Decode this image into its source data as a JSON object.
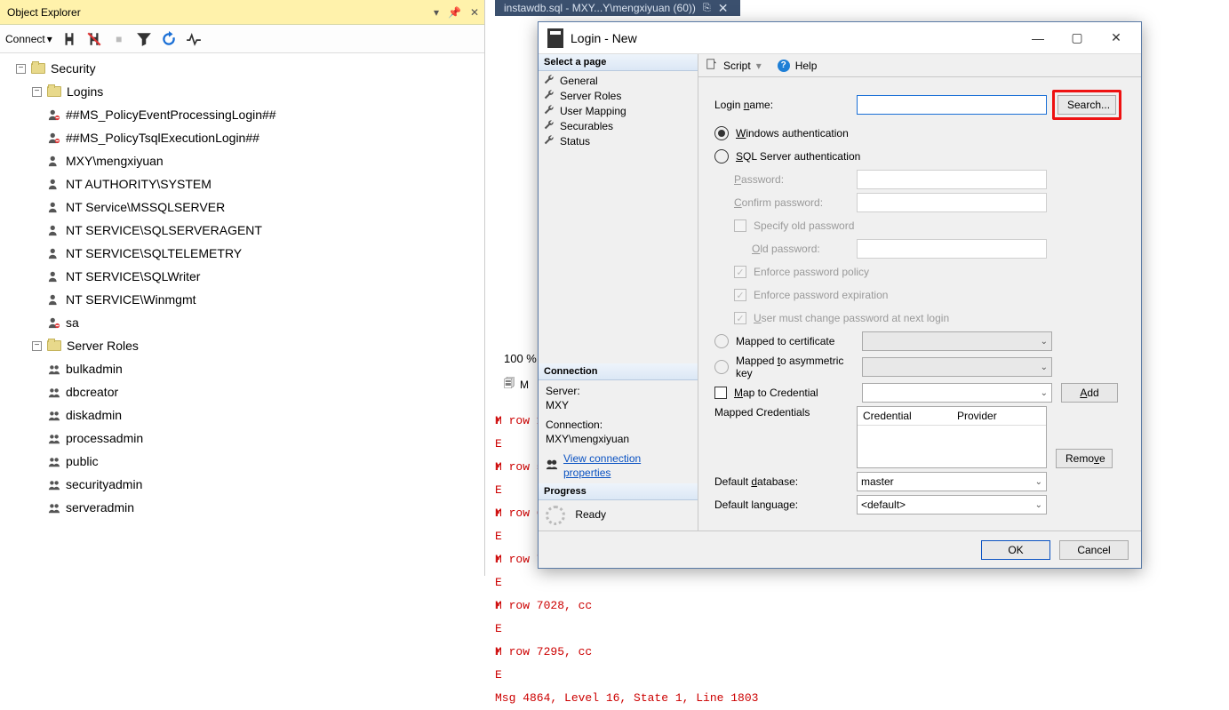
{
  "objectExplorer": {
    "title": "Object Explorer",
    "connectLabel": "Connect",
    "tree": {
      "security": "Security",
      "logins": "Logins",
      "loginItems": [
        "##MS_PolicyEventProcessingLogin##",
        "##MS_PolicyTsqlExecutionLogin##",
        "MXY\\mengxiyuan",
        "NT AUTHORITY\\SYSTEM",
        "NT Service\\MSSQLSERVER",
        "NT SERVICE\\SQLSERVERAGENT",
        "NT SERVICE\\SQLTELEMETRY",
        "NT SERVICE\\SQLWriter",
        "NT SERVICE\\Winmgmt",
        "sa"
      ],
      "serverRoles": "Server Roles",
      "roleItems": [
        "bulkadmin",
        "dbcreator",
        "diskadmin",
        "processadmin",
        "public",
        "securityadmin",
        "serveradmin"
      ]
    }
  },
  "docTab": {
    "label": "instawdb.sql - MXY...Y\\mengxiyuan (60))"
  },
  "bg": {
    "zoom": "100 %",
    "msgIcon": "M",
    "errorsLeft": "M\nE\nM\nE\nM\nE\nM\nE\nM\nE\nM\nE\nMsg 4864, Level 16, State 1, Line 1803",
    "errorsRight": "r row 1687, cc\n\nr row 5167, cc\n\nr row 6612, cc\n\nr row 7020, cc\n\nr row 7028, cc\n\nr row 7295, cc"
  },
  "dialog": {
    "title": "Login - New",
    "leftHeader": "Select a page",
    "pages": [
      "General",
      "Server Roles",
      "User Mapping",
      "Securables",
      "Status"
    ],
    "connHeader": "Connection",
    "serverLbl": "Server:",
    "serverVal": "MXY",
    "connectionLbl": "Connection:",
    "connectionVal": "MXY\\mengxiyuan",
    "viewConn": "View connection properties",
    "progressHeader": "Progress",
    "progressVal": "Ready",
    "scriptLabel": "Script",
    "helpLabel": "Help",
    "loginName": "Login name:",
    "searchBtn": "Search...",
    "winAuth": "Windows authentication",
    "sqlAuth": "SQL Server authentication",
    "password": "Password:",
    "confirm": "Confirm password:",
    "specifyOld": "Specify old password",
    "oldPass": "Old password:",
    "enfPolicy": "Enforce password policy",
    "enfExp": "Enforce password expiration",
    "mustChange": "User must change password at next login",
    "mapCert": "Mapped to certificate",
    "mapAsym": "Mapped to asymmetric key",
    "mapCred": "Map to Credential",
    "addBtn": "Add",
    "mappedCreds": "Mapped Credentials",
    "colCred": "Credential",
    "colProv": "Provider",
    "removeBtn": "Remove",
    "defDb": "Default database:",
    "defDbVal": "master",
    "defLang": "Default language:",
    "defLangVal": "<default>",
    "ok": "OK",
    "cancel": "Cancel"
  }
}
